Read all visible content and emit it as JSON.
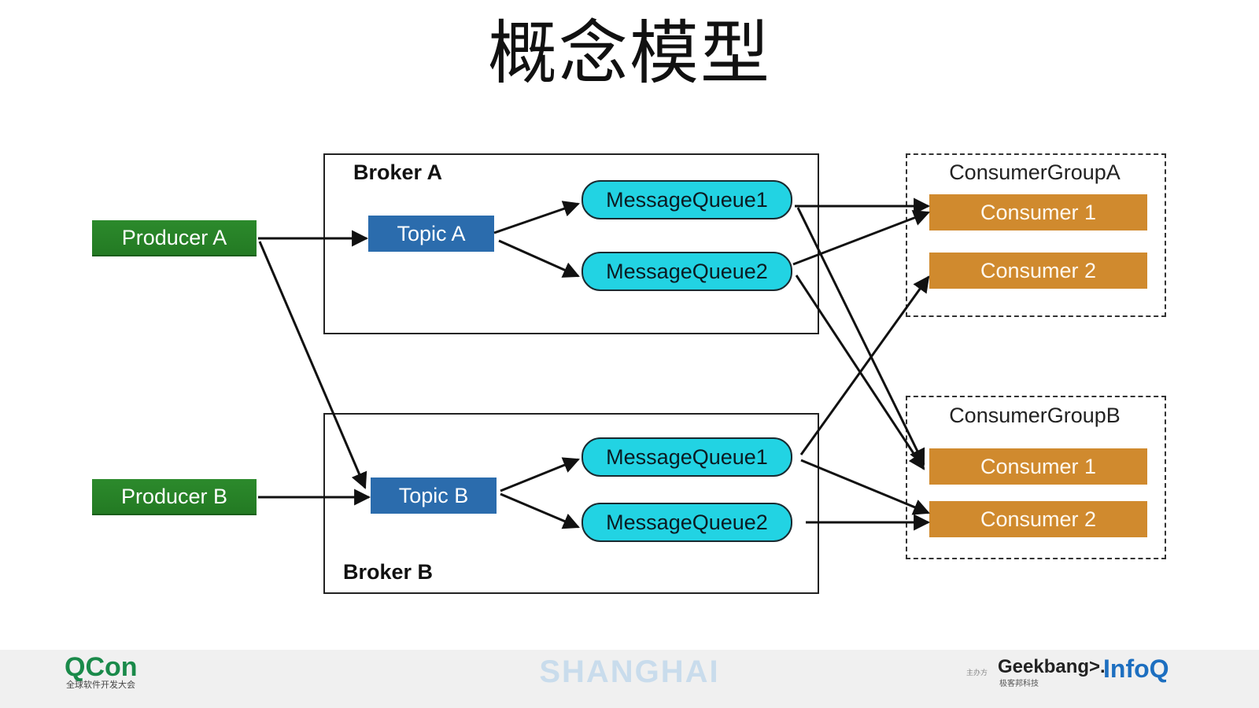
{
  "title": "概念模型",
  "brokers": {
    "a": {
      "label": "Broker A"
    },
    "b": {
      "label": "Broker B"
    }
  },
  "producers": {
    "a": "Producer A",
    "b": "Producer B"
  },
  "topics": {
    "a": "Topic A",
    "b": "Topic B"
  },
  "queues": {
    "a1": "MessageQueue1",
    "a2": "MessageQueue2",
    "b1": "MessageQueue1",
    "b2": "MessageQueue2"
  },
  "consumer_groups": {
    "a": {
      "label": "ConsumerGroupA",
      "consumers": [
        "Consumer 1",
        "Consumer 2"
      ]
    },
    "b": {
      "label": "ConsumerGroupB",
      "consumers": [
        "Consumer 1",
        "Consumer 2"
      ]
    }
  },
  "colors": {
    "producer": "#2c8a2c",
    "topic": "#2b6cad",
    "queue": "#22d3e3",
    "consumer": "#d08a2e",
    "arrow": "#111111"
  },
  "footer": {
    "brand": "QCon",
    "brand_sub": "全球软件开发大会",
    "city": "SHANGHAI",
    "organizer_label": "主办方",
    "partner1": "Geekbang>.",
    "partner1_sub": "极客邦科技",
    "partner2": "InfoQ"
  }
}
